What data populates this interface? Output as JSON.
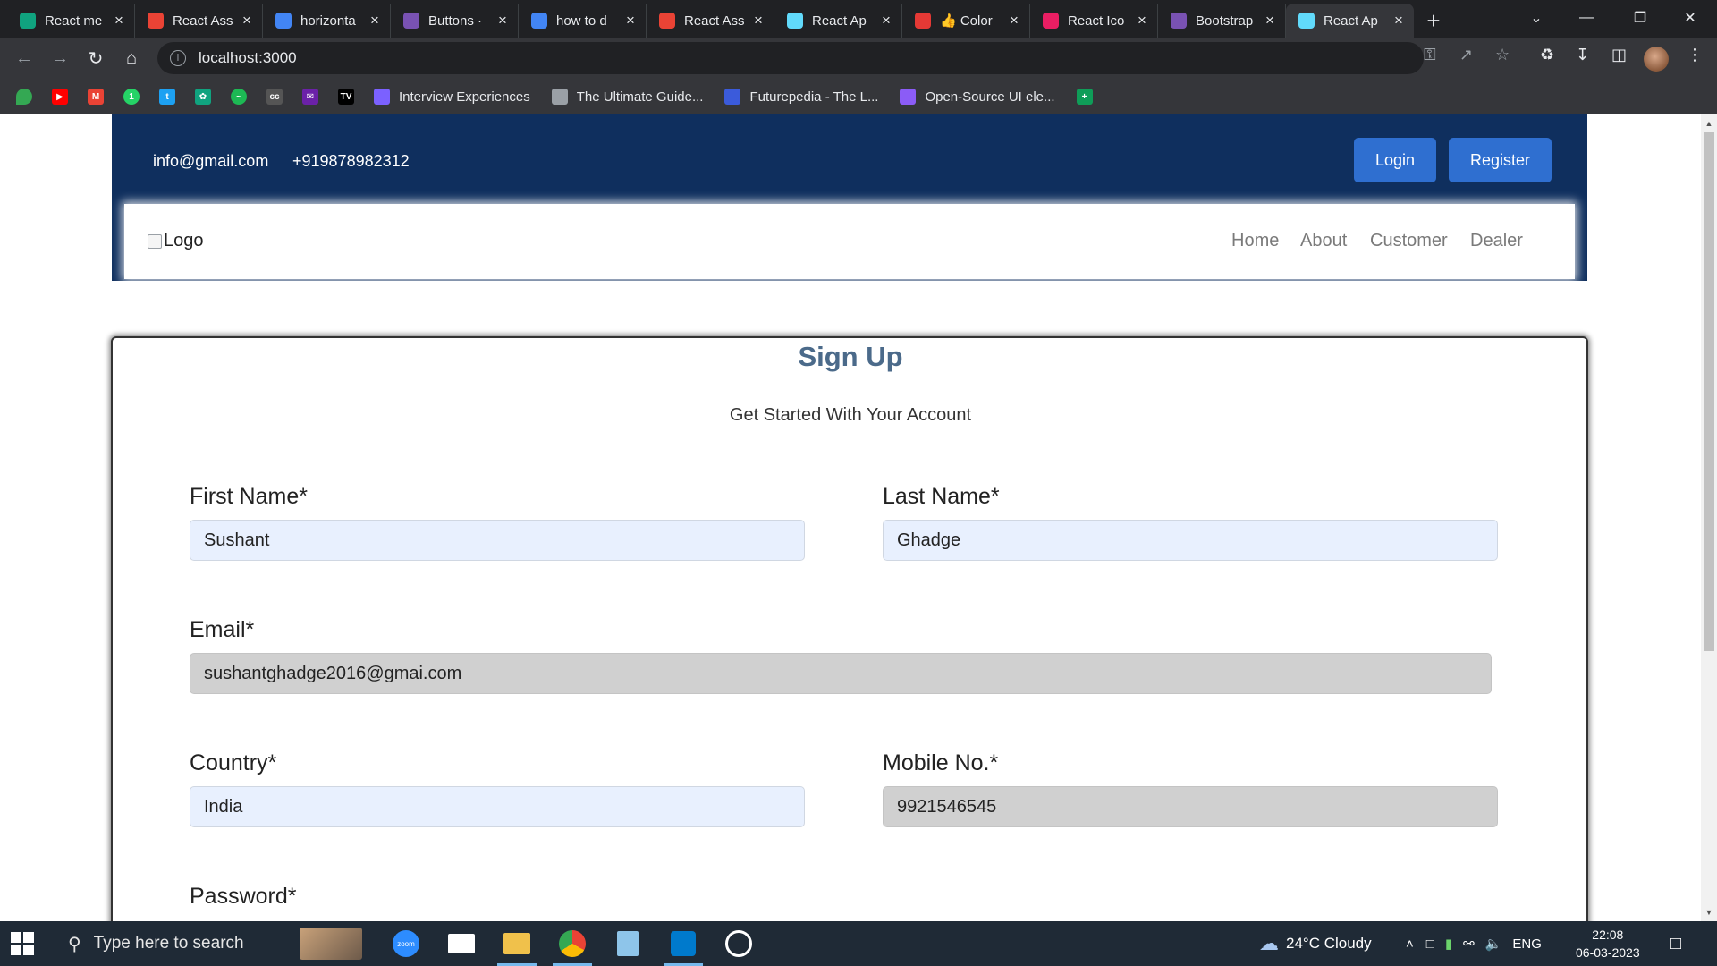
{
  "browser": {
    "tabs": [
      {
        "title": "React me",
        "icon": "chatgpt-icon",
        "color": "#10a37f"
      },
      {
        "title": "React Ass",
        "icon": "gmail-icon",
        "color": "#ea4335"
      },
      {
        "title": "horizonta",
        "icon": "google-icon",
        "color": "#4285f4"
      },
      {
        "title": "Buttons ·",
        "icon": "bootstrap-icon",
        "color": "#7952b3"
      },
      {
        "title": "how to d",
        "icon": "google-icon",
        "color": "#4285f4"
      },
      {
        "title": "React Ass",
        "icon": "gmail-icon",
        "color": "#ea4335"
      },
      {
        "title": "React Ap",
        "icon": "react-icon",
        "color": "#61dafb"
      },
      {
        "title": "👍 Color",
        "icon": "color-picker-icon",
        "color": "#e53935"
      },
      {
        "title": "React Ico",
        "icon": "react-icons-icon",
        "color": "#e91e63"
      },
      {
        "title": "Bootstrap",
        "icon": "bootstrap-icon",
        "color": "#7952b3"
      },
      {
        "title": "React Ap",
        "icon": "react-icon",
        "color": "#61dafb"
      }
    ],
    "active_tab": 10,
    "url": "localhost:3000",
    "bookmarks": [
      {
        "label": "Interview Experiences",
        "icon": "list-icon",
        "color": "#7b61ff"
      },
      {
        "label": "The Ultimate Guide...",
        "icon": "mountain-icon",
        "color": "#9aa0a6"
      },
      {
        "label": "Futurepedia - The L...",
        "icon": "futurepedia-icon",
        "color": "#3b5bdb"
      },
      {
        "label": "Open-Source UI ele...",
        "icon": "uiverse-icon",
        "color": "#8b5cf6"
      }
    ]
  },
  "header": {
    "email": "info@gmail.com",
    "phone": "+919878982312",
    "login_label": "Login",
    "register_label": "Register",
    "logo_alt": "Logo",
    "nav": [
      "Home",
      "About",
      "Customer",
      "Dealer"
    ]
  },
  "form": {
    "title": "Sign Up",
    "subtitle": "Get Started With Your Account",
    "first_name": {
      "label": "First Name*",
      "value": "Sushant"
    },
    "last_name": {
      "label": "Last Name*",
      "value": "Ghadge"
    },
    "email": {
      "label": "Email*",
      "value": "sushantghadge2016@gmai.com"
    },
    "country": {
      "label": "Country*",
      "value": "India"
    },
    "mobile": {
      "label": "Mobile No.*",
      "value": "9921546545"
    },
    "password": {
      "label": "Password*"
    }
  },
  "taskbar": {
    "search_placeholder": "Type here to search",
    "weather": "24°C  Cloudy",
    "language": "ENG",
    "time": "22:08",
    "date": "06-03-2023"
  },
  "colors": {
    "header_bg": "#0f2f5e",
    "button_bg": "#2f6fd0",
    "title": "#4b6a8a",
    "input_bg": "#e8f0fe",
    "input_disabled_bg": "#d0d0d0"
  }
}
